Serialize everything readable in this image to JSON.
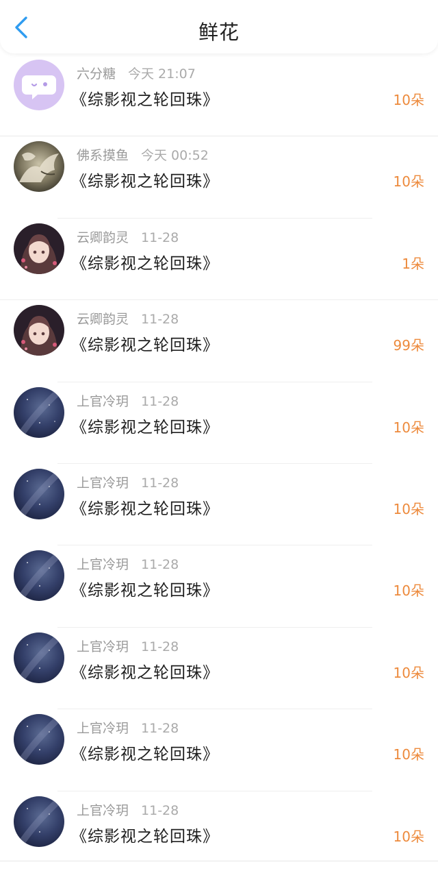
{
  "header": {
    "title": "鲜花",
    "back_icon": "chevron-left-icon",
    "accent_color": "#2f9cf0"
  },
  "items": [
    {
      "user": "六分糖",
      "time": "今天 21:07",
      "book": "《综影视之轮回珠》",
      "amount": "10朵",
      "avatar": "chat-bubble-avatar"
    },
    {
      "user": "佛系摸鱼",
      "time": "今天 00:52",
      "book": "《综影视之轮回珠》",
      "amount": "10朵",
      "avatar": "dragon-avatar"
    },
    {
      "user": "云卿韵灵",
      "time": "11-28",
      "book": "《综影视之轮回珠》",
      "amount": "1朵",
      "avatar": "anime-girl-avatar"
    },
    {
      "user": "云卿韵灵",
      "time": "11-28",
      "book": "《综影视之轮回珠》",
      "amount": "99朵",
      "avatar": "anime-girl-avatar"
    },
    {
      "user": "上官冷玥",
      "time": "11-28",
      "book": "《综影视之轮回珠》",
      "amount": "10朵",
      "avatar": "night-sky-avatar"
    },
    {
      "user": "上官冷玥",
      "time": "11-28",
      "book": "《综影视之轮回珠》",
      "amount": "10朵",
      "avatar": "night-sky-avatar"
    },
    {
      "user": "上官冷玥",
      "time": "11-28",
      "book": "《综影视之轮回珠》",
      "amount": "10朵",
      "avatar": "night-sky-avatar"
    },
    {
      "user": "上官冷玥",
      "time": "11-28",
      "book": "《综影视之轮回珠》",
      "amount": "10朵",
      "avatar": "night-sky-avatar"
    },
    {
      "user": "上官冷玥",
      "time": "11-28",
      "book": "《综影视之轮回珠》",
      "amount": "10朵",
      "avatar": "night-sky-avatar"
    },
    {
      "user": "上官冷玥",
      "time": "11-28",
      "book": "《综影视之轮回珠》",
      "amount": "10朵",
      "avatar": "night-sky-avatar"
    }
  ]
}
